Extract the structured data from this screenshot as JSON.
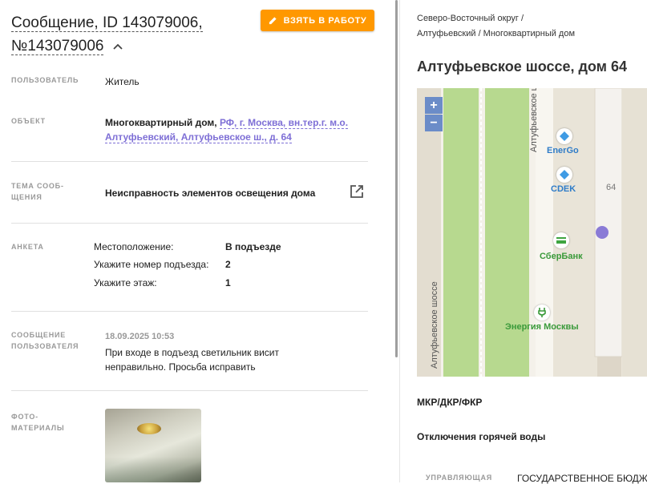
{
  "message": {
    "title_line1": "Сообщение, ID 143079006,",
    "title_line2": "№143079006",
    "take_button": "ВЗЯТЬ В РАБОТУ"
  },
  "fields": {
    "user_label": "ПОЛЬЗОВАТЕЛЬ",
    "user_value": "Житель",
    "object_label": "ОБЪЕКТ",
    "object_prefix": "Многоквартирный дом,",
    "object_link": "РФ, г. Москва, вн.тер.г. м.о. Алтуфьевский, Алтуфьевское ш., д. 64",
    "topic_label_1": "ТЕМА СООБ-",
    "topic_label_2": "ЩЕНИЯ",
    "topic_value": "Неисправность элементов освещения дома",
    "survey_label": "АНКЕТА",
    "survey": [
      {
        "key": "Местоположение:",
        "value": "В подъезде"
      },
      {
        "key": "Укажите номер подъезда:",
        "value": "2"
      },
      {
        "key": "Укажите этаж:",
        "value": "1"
      }
    ],
    "message_label_1": "СООБЩЕНИЕ",
    "message_label_2": "ПОЛЬЗОВАТЕЛЯ",
    "message_date": "18.09.2025 10:53",
    "message_text_1": "При входе в подъезд светильник висит",
    "message_text_2": "неправильно. Просьба исправить",
    "photo_label_1": "ФОТО-",
    "photo_label_2": "МАТЕРИАЛЫ"
  },
  "right": {
    "breadcrumb_1": "Северо-Восточный округ /",
    "breadcrumb_2": "Алтуфьевский / Многоквартирный дом",
    "address": "Алтуфьевское шоссе, дом 64",
    "map": {
      "zoom_in": "+",
      "zoom_out": "−",
      "street_top": "Алтуфьевское шоссе",
      "street_bottom": "Алтуфьевское шоссе",
      "poi_energo": "EnerGo",
      "poi_cdek": "CDEK",
      "house_number": "64",
      "poi_sber": "СберБанк",
      "poi_energy_moscow": "Энергия Москвы"
    },
    "section_1": "МКР/ДКР/ФКР",
    "section_2": "Отключения горячей воды",
    "manage_label": "УПРАВЛЯЮЩАЯ",
    "manage_value": "ГОСУДАРСТВЕННОЕ БЮДЖЕТ"
  },
  "colors": {
    "accent": "#ff9800",
    "link": "#7e6fd6",
    "map_marker": "#8a7bd6",
    "road_green": "#b7d98f"
  }
}
